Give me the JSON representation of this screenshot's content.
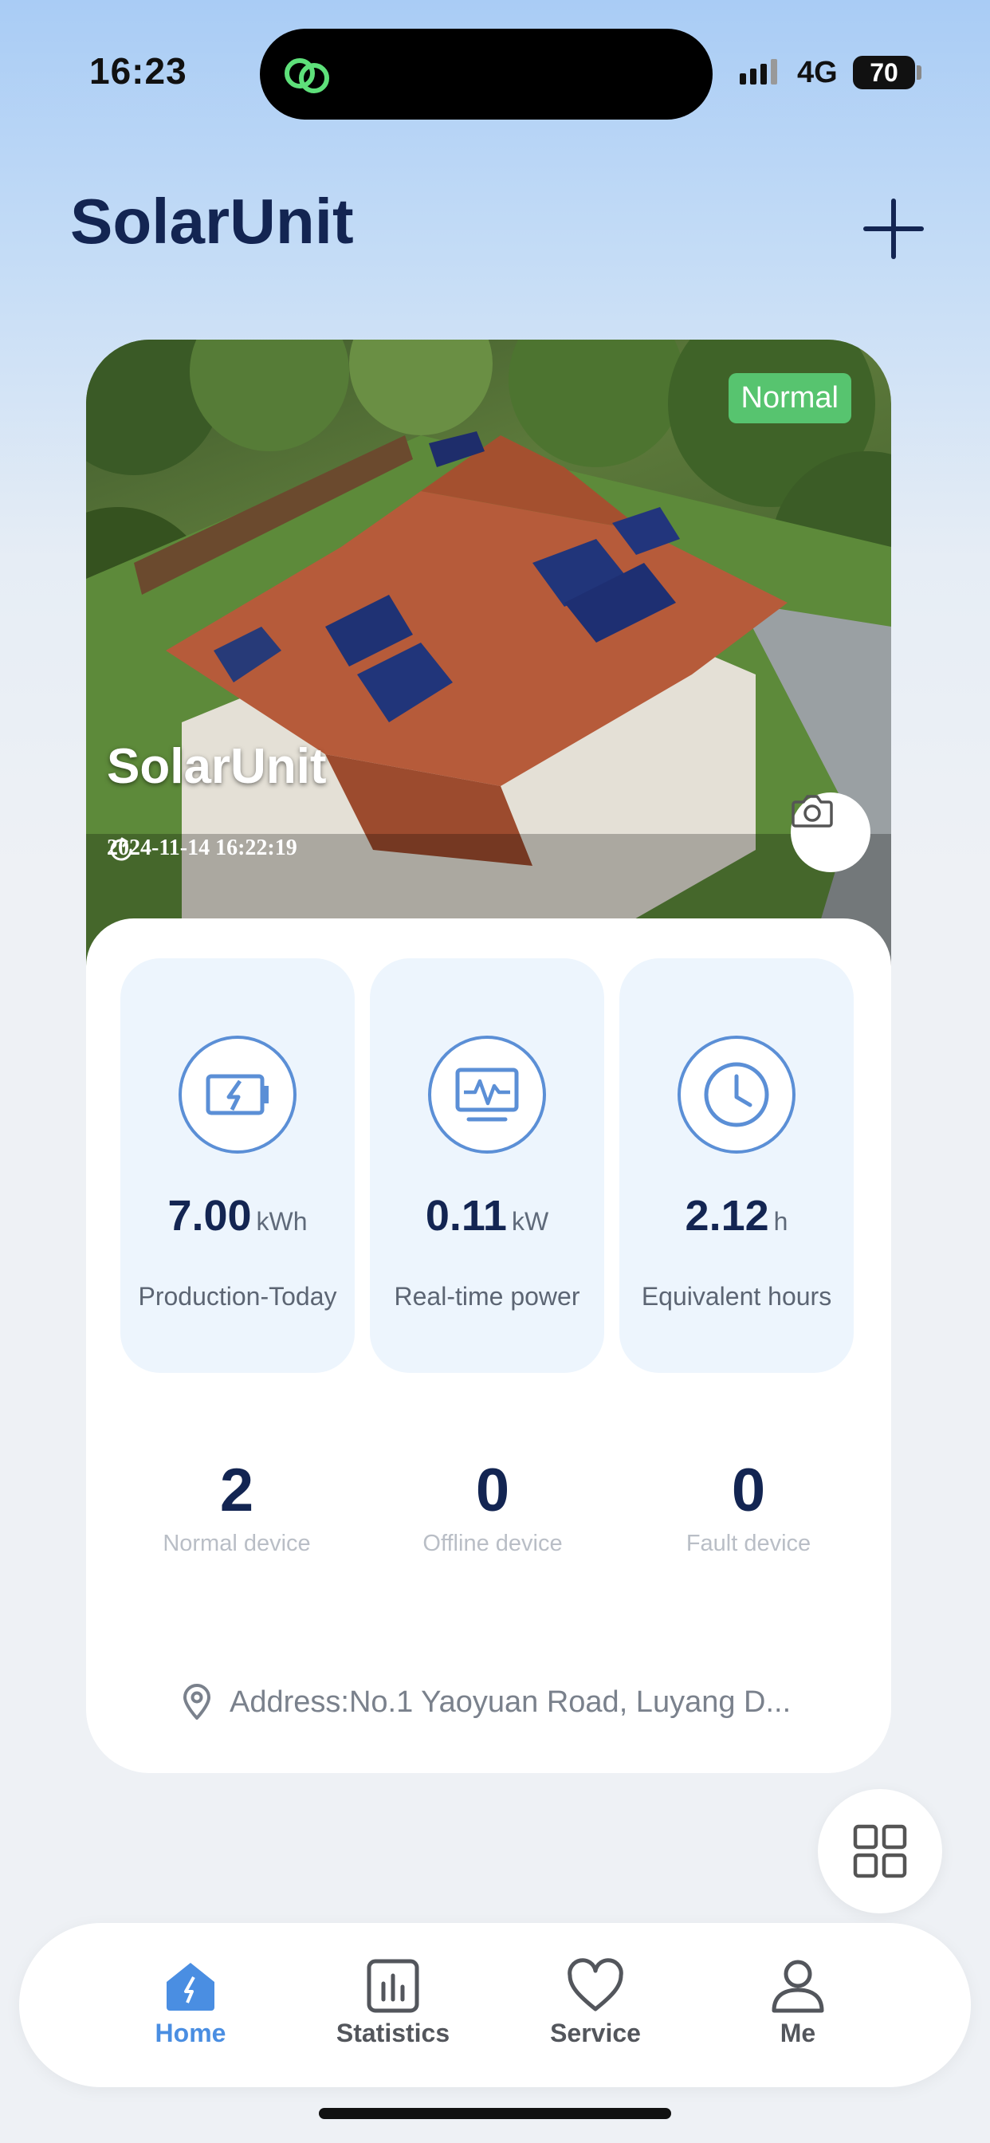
{
  "status_bar": {
    "time": "16:23",
    "network": "4G",
    "battery": "70"
  },
  "header": {
    "title": "SolarUnit",
    "add_icon": "plus-icon"
  },
  "plant": {
    "status_badge": "Normal",
    "name": "SolarUnit",
    "updated_at": "2024-11-14 16:22:19",
    "status_color": "#57c46f"
  },
  "metrics": [
    {
      "value": "7.00",
      "unit": "kWh",
      "label": "Production-Today",
      "icon": "battery-charge-icon"
    },
    {
      "value": "0.11",
      "unit": "kW",
      "label": "Real-time power",
      "icon": "monitor-pulse-icon"
    },
    {
      "value": "2.12",
      "unit": "h",
      "label": "Equivalent hours",
      "icon": "clock-icon"
    }
  ],
  "devices": [
    {
      "count": "2",
      "label": "Normal device"
    },
    {
      "count": "0",
      "label": "Offline device"
    },
    {
      "count": "0",
      "label": "Fault device"
    }
  ],
  "address": "Address:No.1 Yaoyuan Road, Luyang D...",
  "tabs": [
    {
      "label": "Home",
      "active": true
    },
    {
      "label": "Statistics",
      "active": false
    },
    {
      "label": "Service",
      "active": false
    },
    {
      "label": "Me",
      "active": false
    }
  ],
  "accent_color": "#4a8ee2"
}
